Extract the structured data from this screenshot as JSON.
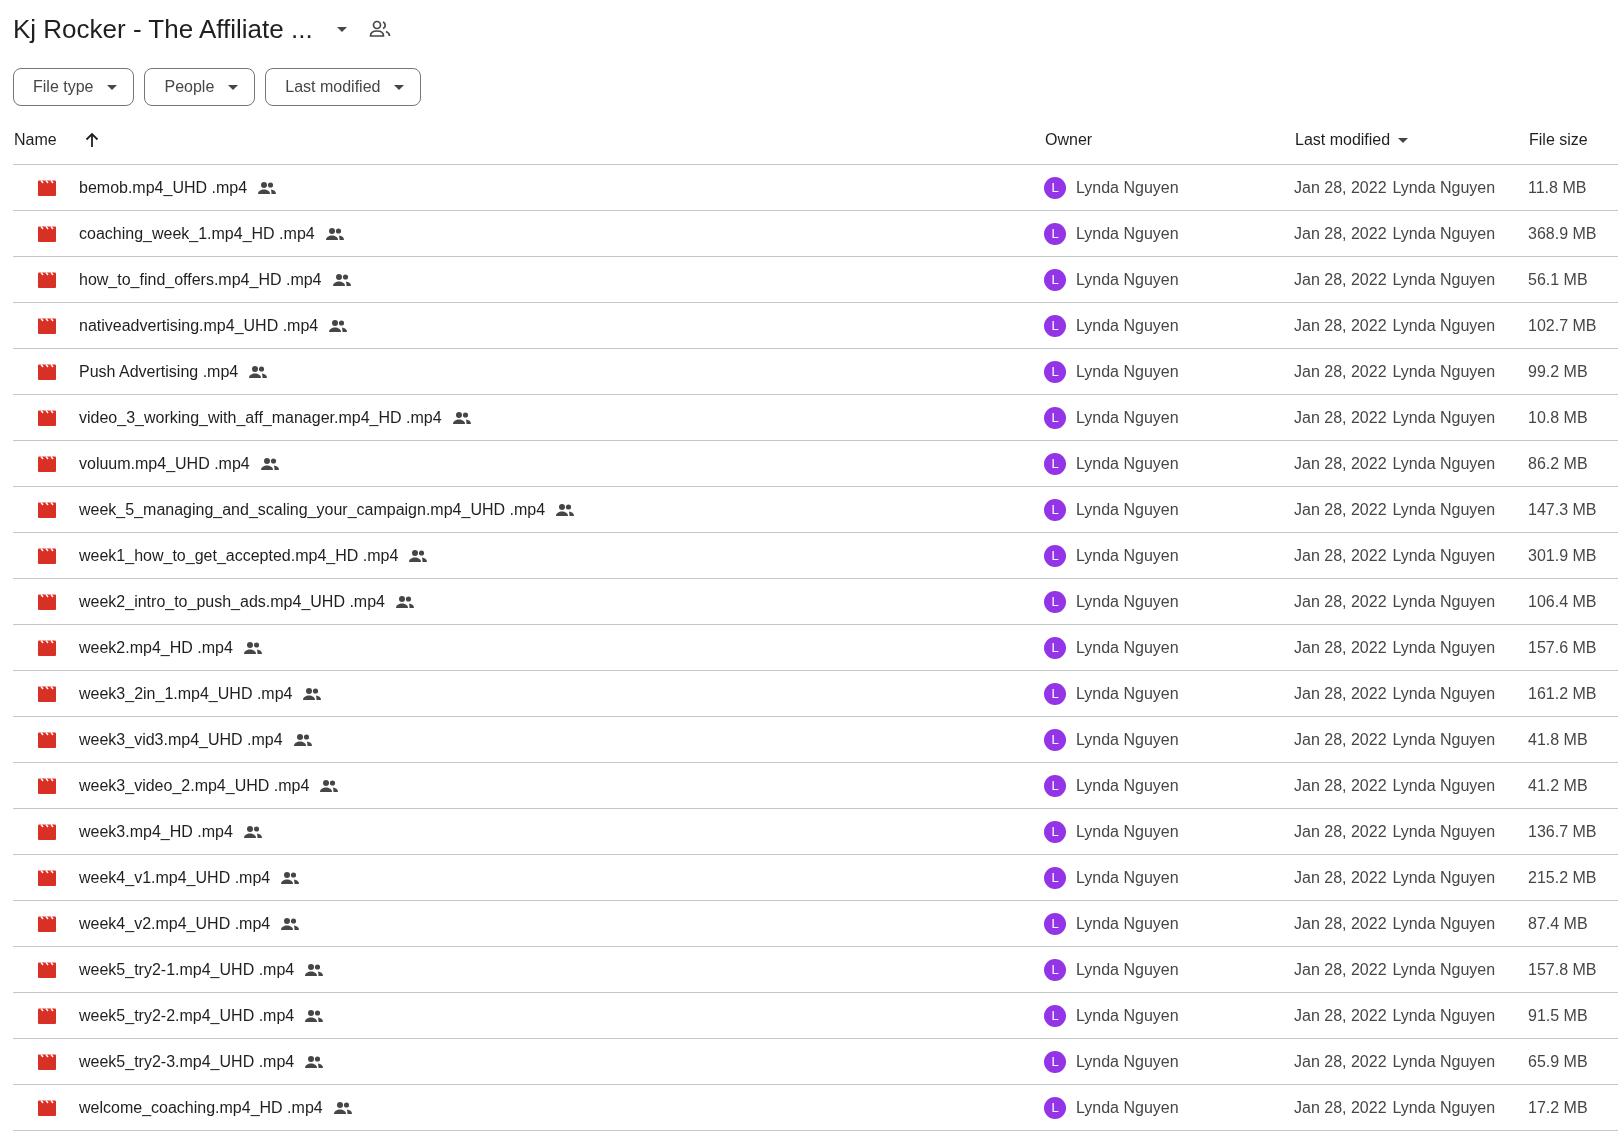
{
  "folder": {
    "title": "Kj Rocker - The Affiliate ..."
  },
  "filters": [
    {
      "label": "File type"
    },
    {
      "label": "People"
    },
    {
      "label": "Last modified"
    }
  ],
  "columns": {
    "name": "Name",
    "owner": "Owner",
    "modified": "Last modified",
    "size": "File size"
  },
  "files": [
    {
      "name": "bemob.mp4_UHD .mp4",
      "owner_initial": "L",
      "owner": "Lynda Nguyen",
      "date": "Jan 28, 2022",
      "modified_by": "Lynda Nguyen",
      "size": "11.8 MB"
    },
    {
      "name": "coaching_week_1.mp4_HD .mp4",
      "owner_initial": "L",
      "owner": "Lynda Nguyen",
      "date": "Jan 28, 2022",
      "modified_by": "Lynda Nguyen",
      "size": "368.9 MB"
    },
    {
      "name": "how_to_find_offers.mp4_HD .mp4",
      "owner_initial": "L",
      "owner": "Lynda Nguyen",
      "date": "Jan 28, 2022",
      "modified_by": "Lynda Nguyen",
      "size": "56.1 MB"
    },
    {
      "name": "nativeadvertising.mp4_UHD .mp4",
      "owner_initial": "L",
      "owner": "Lynda Nguyen",
      "date": "Jan 28, 2022",
      "modified_by": "Lynda Nguyen",
      "size": "102.7 MB"
    },
    {
      "name": "Push Advertising .mp4",
      "owner_initial": "L",
      "owner": "Lynda Nguyen",
      "date": "Jan 28, 2022",
      "modified_by": "Lynda Nguyen",
      "size": "99.2 MB"
    },
    {
      "name": "video_3_working_with_aff_manager.mp4_HD .mp4",
      "owner_initial": "L",
      "owner": "Lynda Nguyen",
      "date": "Jan 28, 2022",
      "modified_by": "Lynda Nguyen",
      "size": "10.8 MB"
    },
    {
      "name": "voluum.mp4_UHD .mp4",
      "owner_initial": "L",
      "owner": "Lynda Nguyen",
      "date": "Jan 28, 2022",
      "modified_by": "Lynda Nguyen",
      "size": "86.2 MB"
    },
    {
      "name": "week_5_managing_and_scaling_your_campaign.mp4_UHD .mp4",
      "owner_initial": "L",
      "owner": "Lynda Nguyen",
      "date": "Jan 28, 2022",
      "modified_by": "Lynda Nguyen",
      "size": "147.3 MB"
    },
    {
      "name": "week1_how_to_get_accepted.mp4_HD .mp4",
      "owner_initial": "L",
      "owner": "Lynda Nguyen",
      "date": "Jan 28, 2022",
      "modified_by": "Lynda Nguyen",
      "size": "301.9 MB"
    },
    {
      "name": "week2_intro_to_push_ads.mp4_UHD .mp4",
      "owner_initial": "L",
      "owner": "Lynda Nguyen",
      "date": "Jan 28, 2022",
      "modified_by": "Lynda Nguyen",
      "size": "106.4 MB"
    },
    {
      "name": "week2.mp4_HD .mp4",
      "owner_initial": "L",
      "owner": "Lynda Nguyen",
      "date": "Jan 28, 2022",
      "modified_by": "Lynda Nguyen",
      "size": "157.6 MB"
    },
    {
      "name": "week3_2in_1.mp4_UHD .mp4",
      "owner_initial": "L",
      "owner": "Lynda Nguyen",
      "date": "Jan 28, 2022",
      "modified_by": "Lynda Nguyen",
      "size": "161.2 MB"
    },
    {
      "name": "week3_vid3.mp4_UHD .mp4",
      "owner_initial": "L",
      "owner": "Lynda Nguyen",
      "date": "Jan 28, 2022",
      "modified_by": "Lynda Nguyen",
      "size": "41.8 MB"
    },
    {
      "name": "week3_video_2.mp4_UHD .mp4",
      "owner_initial": "L",
      "owner": "Lynda Nguyen",
      "date": "Jan 28, 2022",
      "modified_by": "Lynda Nguyen",
      "size": "41.2 MB"
    },
    {
      "name": "week3.mp4_HD .mp4",
      "owner_initial": "L",
      "owner": "Lynda Nguyen",
      "date": "Jan 28, 2022",
      "modified_by": "Lynda Nguyen",
      "size": "136.7 MB"
    },
    {
      "name": "week4_v1.mp4_UHD .mp4",
      "owner_initial": "L",
      "owner": "Lynda Nguyen",
      "date": "Jan 28, 2022",
      "modified_by": "Lynda Nguyen",
      "size": "215.2 MB"
    },
    {
      "name": "week4_v2.mp4_UHD .mp4",
      "owner_initial": "L",
      "owner": "Lynda Nguyen",
      "date": "Jan 28, 2022",
      "modified_by": "Lynda Nguyen",
      "size": "87.4 MB"
    },
    {
      "name": "week5_try2-1.mp4_UHD .mp4",
      "owner_initial": "L",
      "owner": "Lynda Nguyen",
      "date": "Jan 28, 2022",
      "modified_by": "Lynda Nguyen",
      "size": "157.8 MB"
    },
    {
      "name": "week5_try2-2.mp4_UHD .mp4",
      "owner_initial": "L",
      "owner": "Lynda Nguyen",
      "date": "Jan 28, 2022",
      "modified_by": "Lynda Nguyen",
      "size": "91.5 MB"
    },
    {
      "name": "week5_try2-3.mp4_UHD .mp4",
      "owner_initial": "L",
      "owner": "Lynda Nguyen",
      "date": "Jan 28, 2022",
      "modified_by": "Lynda Nguyen",
      "size": "65.9 MB"
    },
    {
      "name": "welcome_coaching.mp4_HD .mp4",
      "owner_initial": "L",
      "owner": "Lynda Nguyen",
      "date": "Jan 28, 2022",
      "modified_by": "Lynda Nguyen",
      "size": "17.2 MB"
    }
  ]
}
